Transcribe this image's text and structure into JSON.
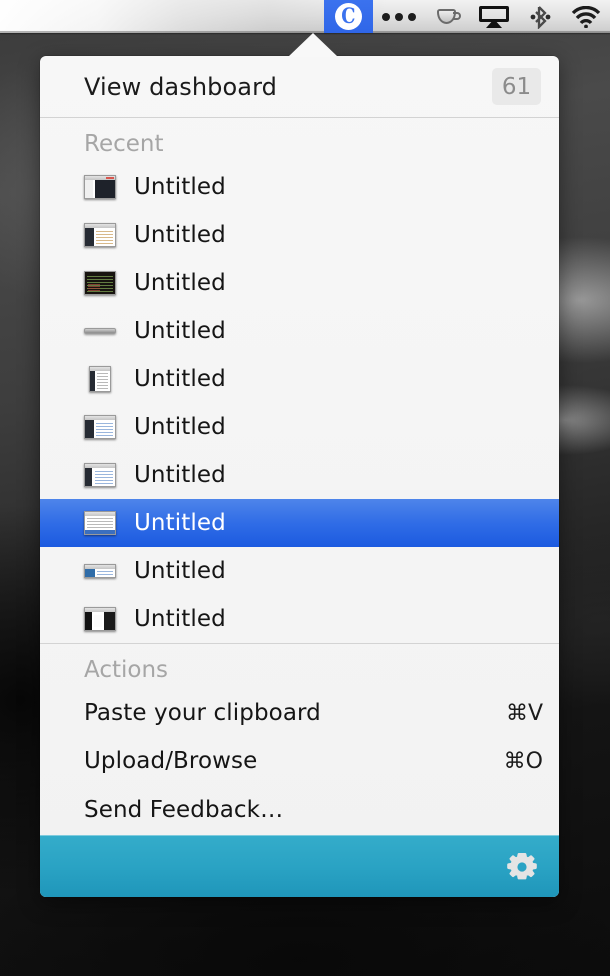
{
  "menubar": {
    "items": [
      {
        "name": "cloudapp-menu-icon",
        "icon": "cloudapp-logo-icon",
        "label": "C",
        "active": true
      },
      {
        "name": "dots-menu-icon",
        "icon": "three-dots-icon",
        "label": "",
        "active": false
      },
      {
        "name": "caffeine-menu-icon",
        "icon": "coffee-cup-icon",
        "label": "",
        "active": false
      },
      {
        "name": "airplay-menu-icon",
        "icon": "airplay-icon",
        "label": "",
        "active": false
      },
      {
        "name": "bluetooth-menu-icon",
        "icon": "bluetooth-icon",
        "label": "",
        "active": false
      },
      {
        "name": "wifi-menu-icon",
        "icon": "wifi-icon",
        "label": "",
        "active": false
      }
    ]
  },
  "panel": {
    "header": {
      "title": "View dashboard",
      "badge": "61"
    },
    "recent": {
      "label": "Recent",
      "items": [
        {
          "label": "Untitled",
          "thumb": "window-split-dark-right",
          "selected": false
        },
        {
          "label": "Untitled",
          "thumb": "document-dark-sidebar",
          "selected": false
        },
        {
          "label": "Untitled",
          "thumb": "terminal-dark",
          "selected": false
        },
        {
          "label": "Untitled",
          "thumb": "thin-titlebar-strip",
          "selected": false
        },
        {
          "label": "Untitled",
          "thumb": "portrait-list-window",
          "selected": false
        },
        {
          "label": "Untitled",
          "thumb": "browser-dark-sidebar",
          "selected": false
        },
        {
          "label": "Untitled",
          "thumb": "browser-dark-sidebar-2",
          "selected": false
        },
        {
          "label": "Untitled",
          "thumb": "spreadsheet-window",
          "selected": true
        },
        {
          "label": "Untitled",
          "thumb": "wide-short-window",
          "selected": false
        },
        {
          "label": "Untitled",
          "thumb": "window-dark-right-panel",
          "selected": false
        }
      ]
    },
    "actions": {
      "label": "Actions",
      "items": [
        {
          "label": "Paste your clipboard",
          "shortcut": "⌘V"
        },
        {
          "label": "Upload/Browse",
          "shortcut": "⌘O"
        },
        {
          "label": "Send Feedback…",
          "shortcut": ""
        }
      ]
    },
    "footer": {
      "settings_icon": "gear-icon"
    }
  },
  "colors": {
    "accent_blue": "#2f6ce6",
    "footer_teal": "#2aa3c4",
    "panel_bg": "#f4f4f4",
    "section_label": "#a6a6a6",
    "badge_bg": "#e9e9e9"
  }
}
